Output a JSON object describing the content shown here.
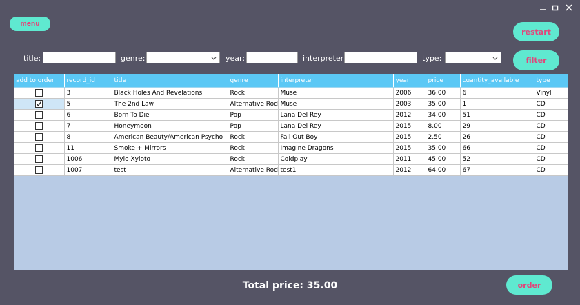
{
  "window": {
    "minimize_icon": "minimize-icon",
    "maximize_icon": "maximize-icon",
    "close_icon": "close-icon"
  },
  "buttons": {
    "menu": "menu",
    "restart": "restart",
    "filter": "filter",
    "order": "order"
  },
  "filters": {
    "title_label": "title:",
    "title_value": "",
    "genre_label": "genre:",
    "genre_value": "",
    "year_label": "year:",
    "year_value": "",
    "interpreter_label": "interpreter:",
    "interpreter_value": "",
    "type_label": "type:",
    "type_value": ""
  },
  "table": {
    "columns": [
      "add to order",
      "record_id",
      "title",
      "genre",
      "interpreter",
      "year",
      "price",
      "cuantity_available",
      "type"
    ],
    "rows": [
      {
        "checked": false,
        "record_id": "3",
        "title": "Black Holes And Revelations",
        "genre": "Rock",
        "interpreter": "Muse",
        "year": "2006",
        "price": "36.00",
        "quantity": "6",
        "type": "Vinyl"
      },
      {
        "checked": true,
        "record_id": "5",
        "title": "The 2nd Law",
        "genre": "Alternative Rock",
        "interpreter": "Muse",
        "year": "2003",
        "price": "35.00",
        "quantity": "1",
        "type": "CD"
      },
      {
        "checked": false,
        "record_id": "6",
        "title": "Born To Die",
        "genre": "Pop",
        "interpreter": "Lana Del Rey",
        "year": "2012",
        "price": "34.00",
        "quantity": "51",
        "type": "CD"
      },
      {
        "checked": false,
        "record_id": "7",
        "title": "Honeymoon",
        "genre": "Pop",
        "interpreter": "Lana Del Rey",
        "year": "2015",
        "price": "8.00",
        "quantity": "29",
        "type": "CD"
      },
      {
        "checked": false,
        "record_id": "8",
        "title": "American Beauty/American Psycho",
        "genre": "Rock",
        "interpreter": "Fall Out Boy",
        "year": "2015",
        "price": "2.50",
        "quantity": "26",
        "type": "CD"
      },
      {
        "checked": false,
        "record_id": "11",
        "title": "Smoke + Mirrors",
        "genre": "Rock",
        "interpreter": "Imagine Dragons",
        "year": "2015",
        "price": "35.00",
        "quantity": "66",
        "type": "CD"
      },
      {
        "checked": false,
        "record_id": "1006",
        "title": "Mylo Xyloto",
        "genre": "Rock",
        "interpreter": "Coldplay",
        "year": "2011",
        "price": "45.00",
        "quantity": "52",
        "type": "CD"
      },
      {
        "checked": false,
        "record_id": "1007",
        "title": "test",
        "genre": "Alternative Rock",
        "interpreter": "test1",
        "year": "2012",
        "price": "64.00",
        "quantity": "67",
        "type": "CD"
      }
    ]
  },
  "footer": {
    "total_price": "Total price: 35.00"
  },
  "colors": {
    "background": "#555465",
    "button": "#5fe9d0",
    "button_text": "#e2457a",
    "header": "#5bc8f5",
    "grid_empty": "#b8cbe5"
  }
}
